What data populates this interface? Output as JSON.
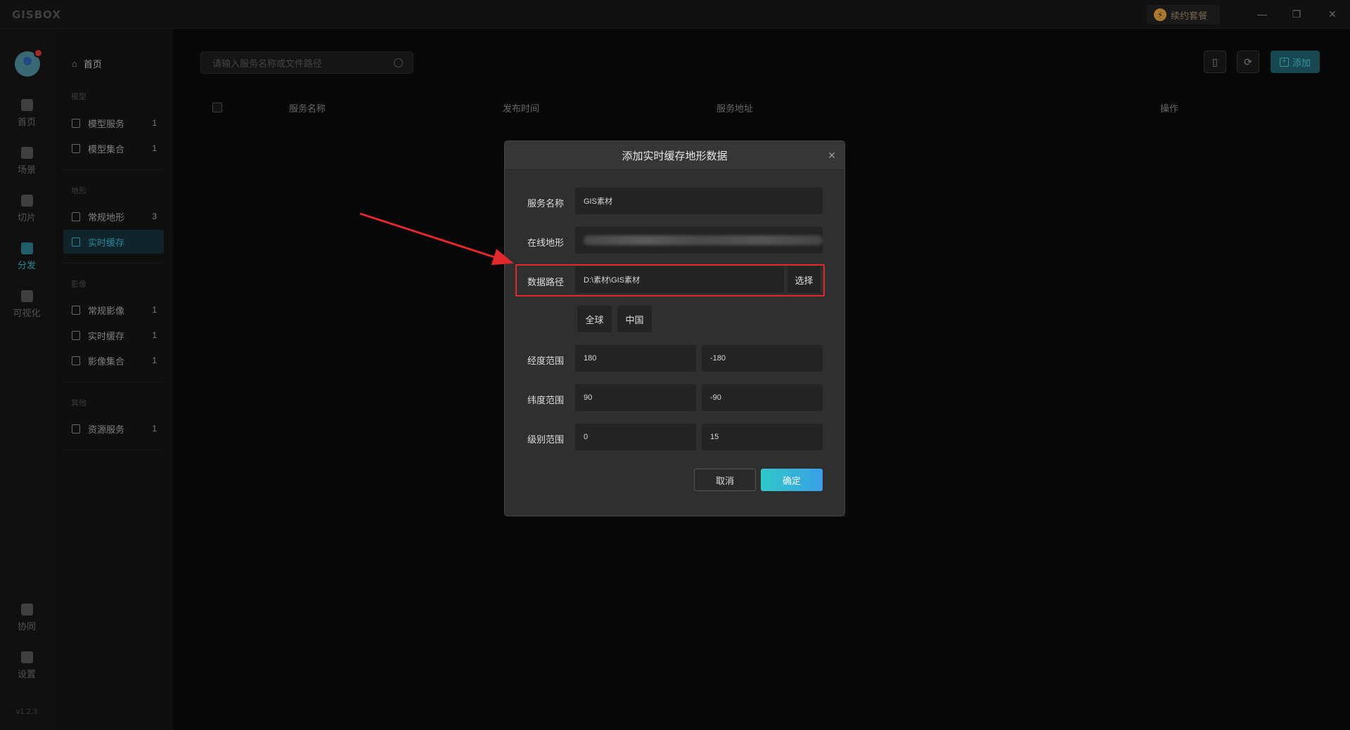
{
  "app": {
    "logo": "GISBOX",
    "upgrade_label": "续约套餐",
    "version": "v1.2.3",
    "window_controls": [
      "minimize-icon",
      "restore-icon",
      "close-icon"
    ]
  },
  "rail": {
    "items": [
      {
        "label": "首页",
        "icon": "home-icon",
        "active": false
      },
      {
        "label": "场景",
        "icon": "cube-icon",
        "active": false
      },
      {
        "label": "切片",
        "icon": "slice-icon",
        "active": false
      },
      {
        "label": "分发",
        "icon": "distribute-icon",
        "active": true
      },
      {
        "label": "可视化",
        "icon": "visualize-icon",
        "active": false
      }
    ],
    "bottom_items": [
      {
        "label": "协同",
        "icon": "lock-icon"
      },
      {
        "label": "设置",
        "icon": "gear-icon"
      }
    ]
  },
  "subnav": {
    "home": "首页",
    "groups": [
      {
        "title": "模型",
        "items": [
          {
            "label": "模型服务",
            "count": "1"
          },
          {
            "label": "模型集合",
            "count": "1"
          }
        ]
      },
      {
        "title": "地形",
        "items": [
          {
            "label": "常规地形",
            "count": "3"
          },
          {
            "label": "实时缓存",
            "count": "",
            "active": true
          }
        ]
      },
      {
        "title": "影像",
        "items": [
          {
            "label": "常规影像",
            "count": "1"
          },
          {
            "label": "实时缓存",
            "count": "1"
          },
          {
            "label": "影像集合",
            "count": "1"
          }
        ]
      },
      {
        "title": "其他",
        "items": [
          {
            "label": "资源服务",
            "count": "1"
          }
        ]
      }
    ]
  },
  "main": {
    "search_placeholder": "请输入服务名称或文件路径",
    "add_label": "添加",
    "table_headers": [
      "服务名称",
      "发布时间",
      "服务地址",
      "操作"
    ]
  },
  "modal": {
    "title": "添加实时缓存地形数据",
    "service_name_label": "服务名称",
    "service_name_value": "GIS素材",
    "online_terrain_label": "在线地形",
    "data_path_label": "数据路径",
    "data_path_value": "D:\\素材\\GIS素材",
    "select_label": "选择",
    "preset_global": "全球",
    "preset_china": "中国",
    "lon_label": "经度范围",
    "lon_min": "180",
    "lon_max": "-180",
    "lat_label": "纬度范围",
    "lat_min": "90",
    "lat_max": "-90",
    "level_label": "级别范围",
    "level_min": "0",
    "level_max": "15",
    "cancel_label": "取消",
    "ok_label": "确定"
  },
  "colors": {
    "accent": "#34b6c9",
    "annotation": "#e0282d"
  }
}
